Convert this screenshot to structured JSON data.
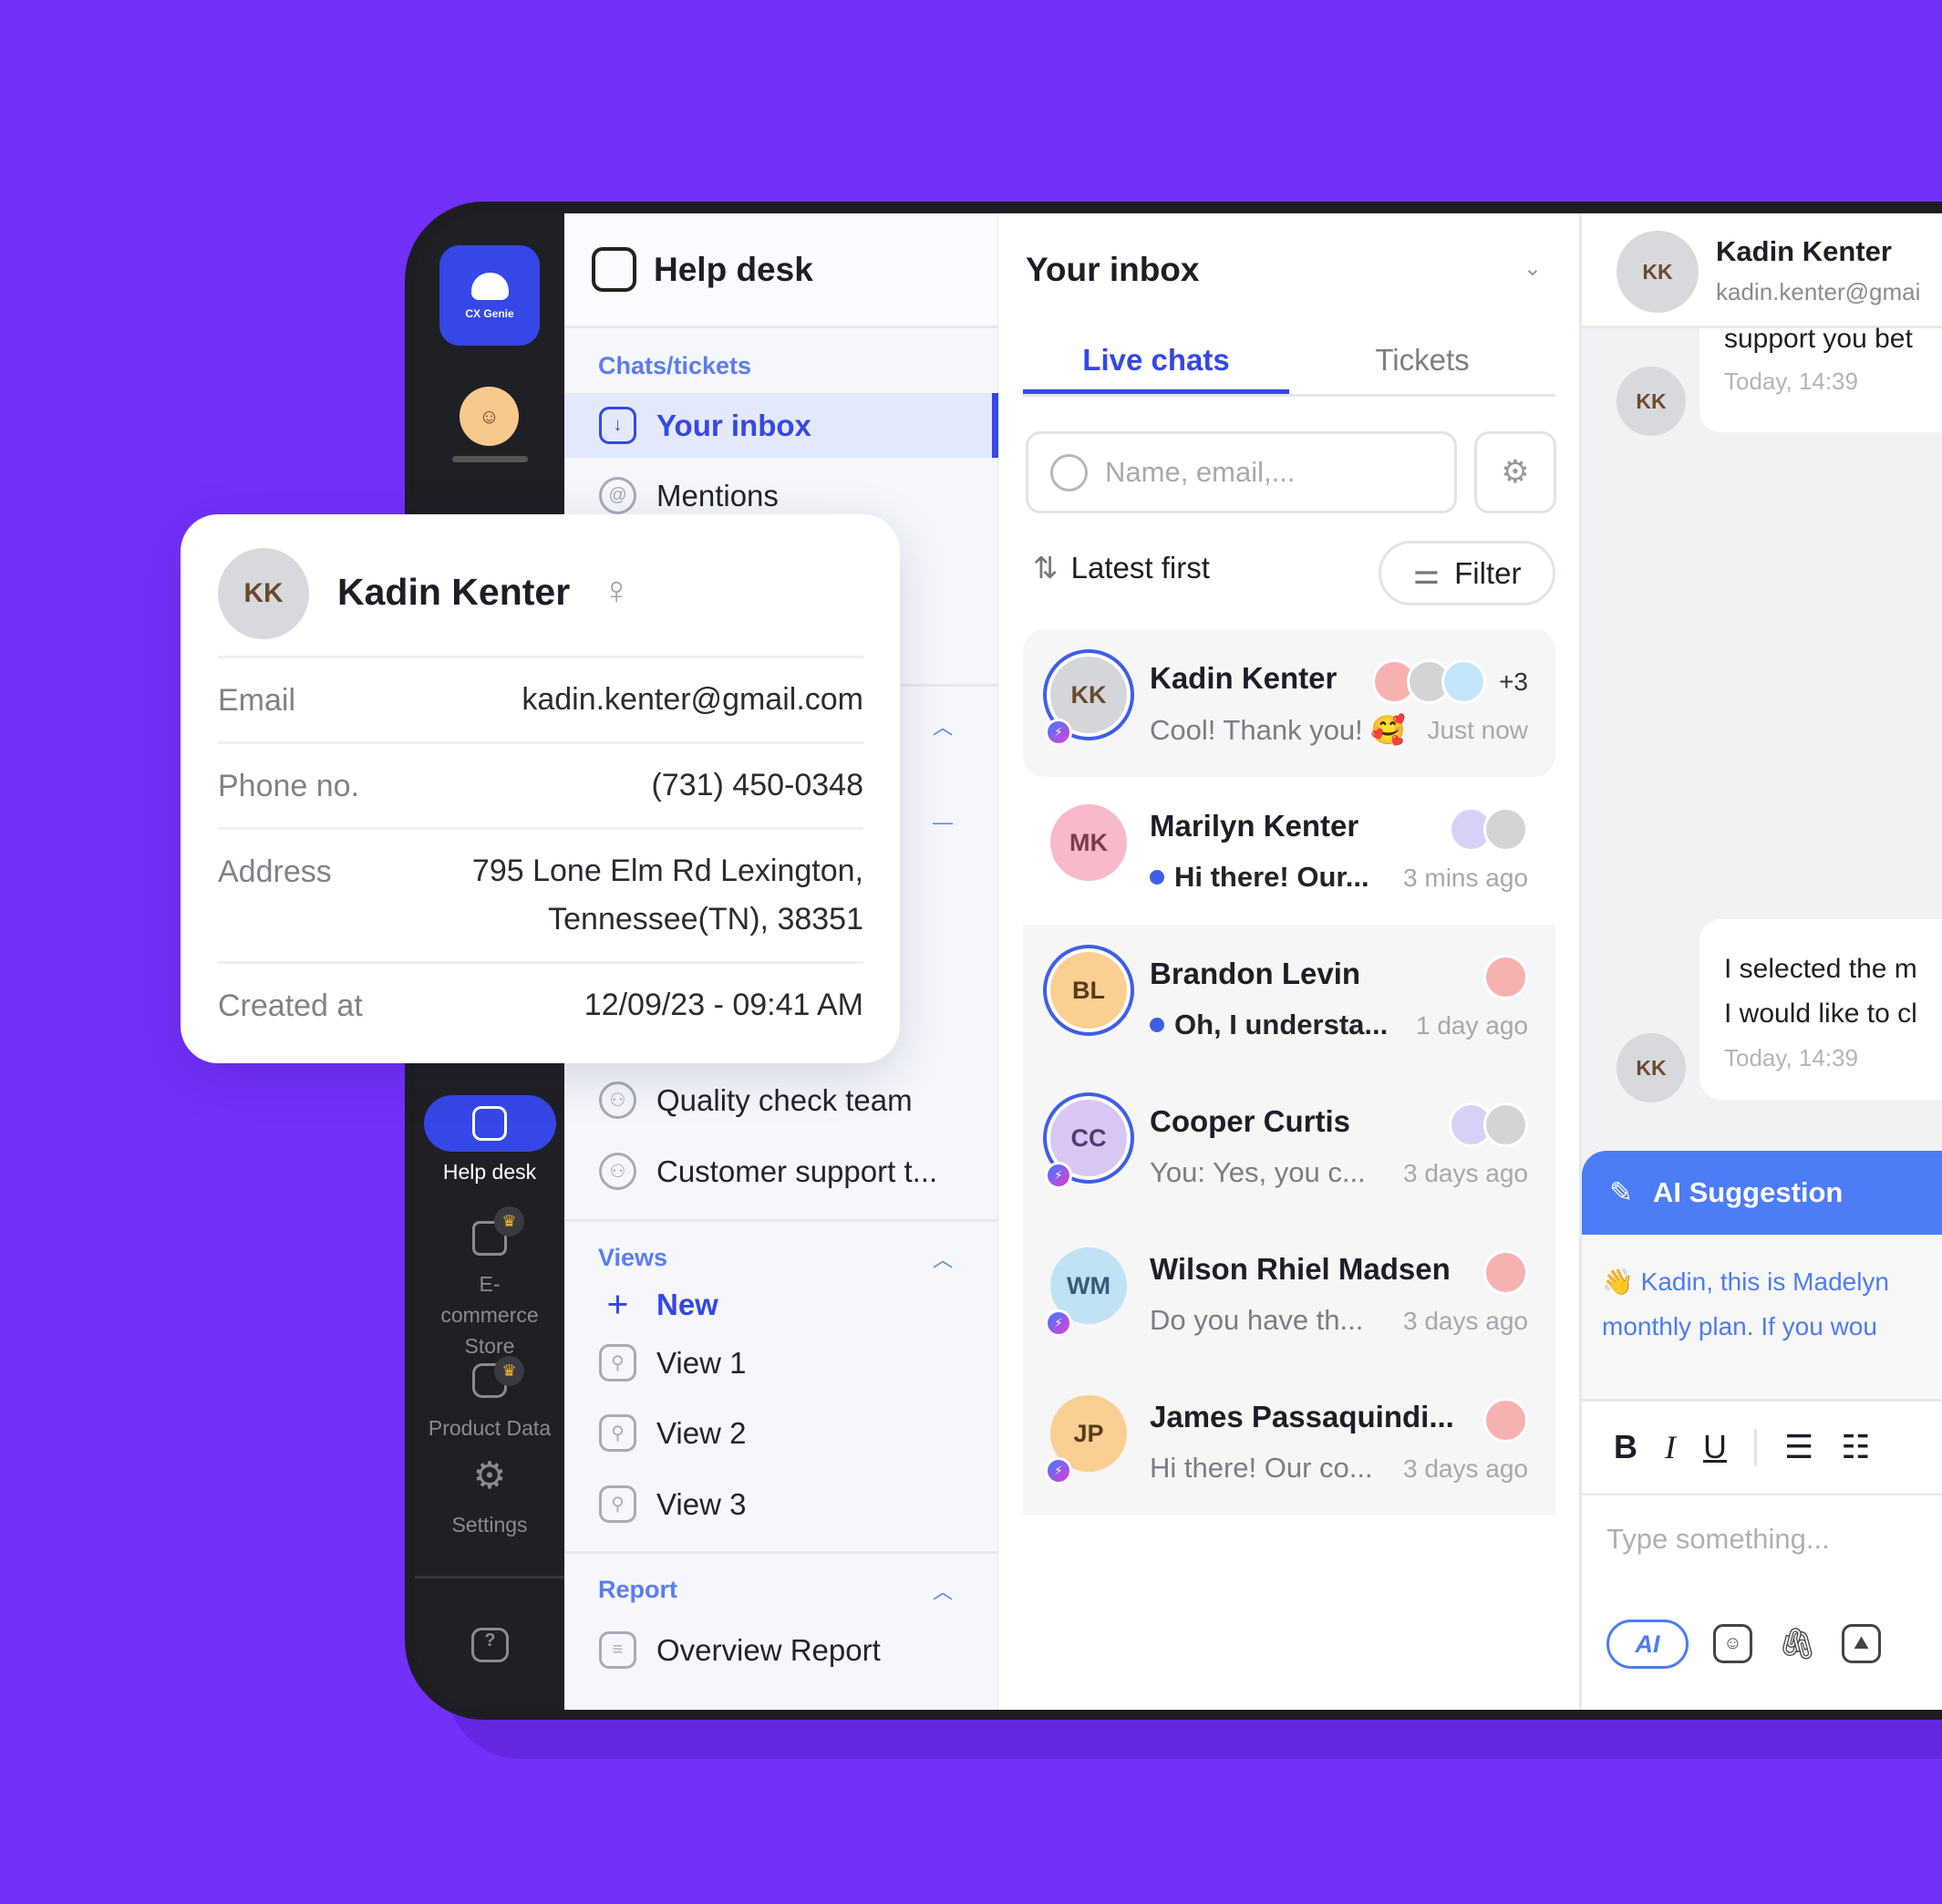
{
  "rail": {
    "logo_text": "CX Genie",
    "items": [
      {
        "label": "Help desk",
        "icon": "helpdesk-icon"
      },
      {
        "label": "E-commerce Store",
        "icon": "store-icon"
      },
      {
        "label": "Product Data",
        "icon": "database-icon"
      },
      {
        "label": "Settings",
        "icon": "gear-icon"
      }
    ],
    "help_icon": "?"
  },
  "nav": {
    "title": "Help desk",
    "sections": {
      "chats": "Chats/tickets",
      "views": "Views",
      "report": "Report"
    },
    "chats_items": [
      "Your inbox",
      "Mentions"
    ],
    "team_items": [
      "Quality check team",
      "Customer support t..."
    ],
    "views_new": "New",
    "views_items": [
      "View 1",
      "View 2",
      "View 3"
    ],
    "report_items": [
      "Overview Report"
    ]
  },
  "inbox": {
    "title": "Your inbox",
    "tabs": [
      "Live chats",
      "Tickets"
    ],
    "search_placeholder": "Name, email,...",
    "sort": "Latest first",
    "filter": "Filter",
    "conversations": [
      {
        "name": "Kadin Kenter",
        "preview": "Cool! Thank you! 🥰",
        "time": "Just now",
        "unread": false,
        "extra_agents": "+3",
        "color": "#d5d6da"
      },
      {
        "name": "Marilyn Kenter",
        "preview": "Hi there! Our...",
        "time": "3 mins ago",
        "unread": true,
        "color": "#f8b9c8"
      },
      {
        "name": "Brandon Levin",
        "preview": "Oh, I understa...",
        "time": "1 day ago",
        "unread": true,
        "color": "#f9cf92"
      },
      {
        "name": "Cooper Curtis",
        "preview": "You: Yes, you c...",
        "time": "3 days ago",
        "unread": false,
        "color": "#d9c6f2"
      },
      {
        "name": "Wilson Rhiel Madsen",
        "preview": "Do you have th...",
        "time": "3 days ago",
        "unread": false,
        "color": "#bfe3f5"
      },
      {
        "name": "James Passaquindi...",
        "preview": "Hi there! Our co...",
        "time": "3 days ago",
        "unread": false,
        "color": "#f9cf92"
      }
    ]
  },
  "chat": {
    "name": "Kadin Kenter",
    "email": "kadin.kenter@gmai",
    "messages": [
      {
        "text": "support you bet",
        "time": "Today, 14:39"
      },
      {
        "text": "I selected the m\nI would like to cl",
        "line1": "I selected the m",
        "line2": "I would like to cl",
        "time": "Today, 14:39"
      }
    ],
    "ai_title": "AI Suggestion",
    "ai_line1": "👋 Kadin, this is Madelyn",
    "ai_line2": "monthly plan. If you wou",
    "toolbar": [
      "B",
      "I",
      "U"
    ],
    "placeholder": "Type something...",
    "ai_button": "AI"
  },
  "contact_card": {
    "name": "Kadin Kenter",
    "gender_icon": "♀",
    "fields": [
      {
        "label": "Email",
        "value": "kadin.kenter@gmail.com"
      },
      {
        "label": "Phone no.",
        "value": "(731) 450-0348"
      },
      {
        "label": "Address",
        "value": "795 Lone Elm Rd Lexington,",
        "value2": "Tennessee(TN), 38351"
      },
      {
        "label": "Created at",
        "value": "12/09/23 - 09:41 AM"
      }
    ]
  },
  "colors": {
    "background": "#7230fb",
    "accent": "#3547e6",
    "ai": "#4c7cf6"
  }
}
